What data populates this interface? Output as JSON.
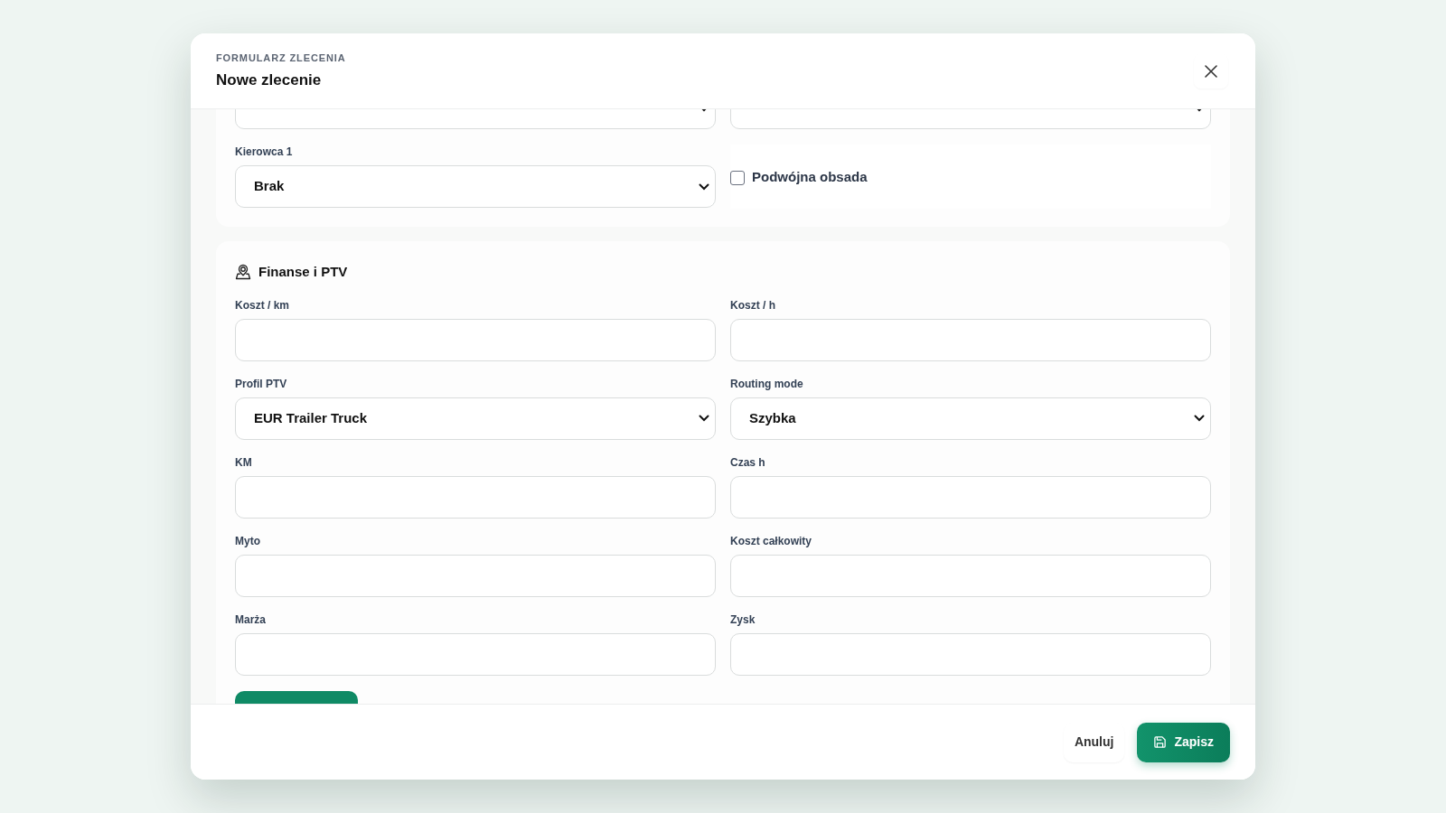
{
  "header": {
    "eyebrow": "FORMULARZ ZLECENIA",
    "title": "Nowe zlecenie"
  },
  "sections": [
    {
      "fields": [
        {
          "kind": "select"
        },
        {
          "kind": "select"
        },
        {
          "kind": "select",
          "label": "Kierowca 1",
          "value": "Brak"
        },
        {
          "kind": "checkbox",
          "label": "Podwójna obsada",
          "checked": false
        }
      ]
    },
    {
      "title": "Finanse i PTV",
      "fields": [
        {
          "kind": "input",
          "label": "Koszt / km"
        },
        {
          "kind": "input",
          "label": "Koszt / h"
        },
        {
          "kind": "select",
          "label": "Profil PTV",
          "value": "EUR Trailer Truck"
        },
        {
          "kind": "select",
          "label": "Routing mode",
          "value": "Szybka"
        },
        {
          "kind": "input",
          "label": "KM"
        },
        {
          "kind": "input",
          "label": "Czas h"
        },
        {
          "kind": "input",
          "label": "Myto"
        },
        {
          "kind": "input",
          "label": "Koszt całkowity"
        },
        {
          "kind": "input",
          "label": "Marża"
        },
        {
          "kind": "input",
          "label": "Zysk"
        }
      ]
    }
  ],
  "footer": {
    "buttons": [
      {
        "kind": "secondary",
        "label": "Anuluj"
      },
      {
        "kind": "primary",
        "label": "Zapisz"
      }
    ]
  }
}
